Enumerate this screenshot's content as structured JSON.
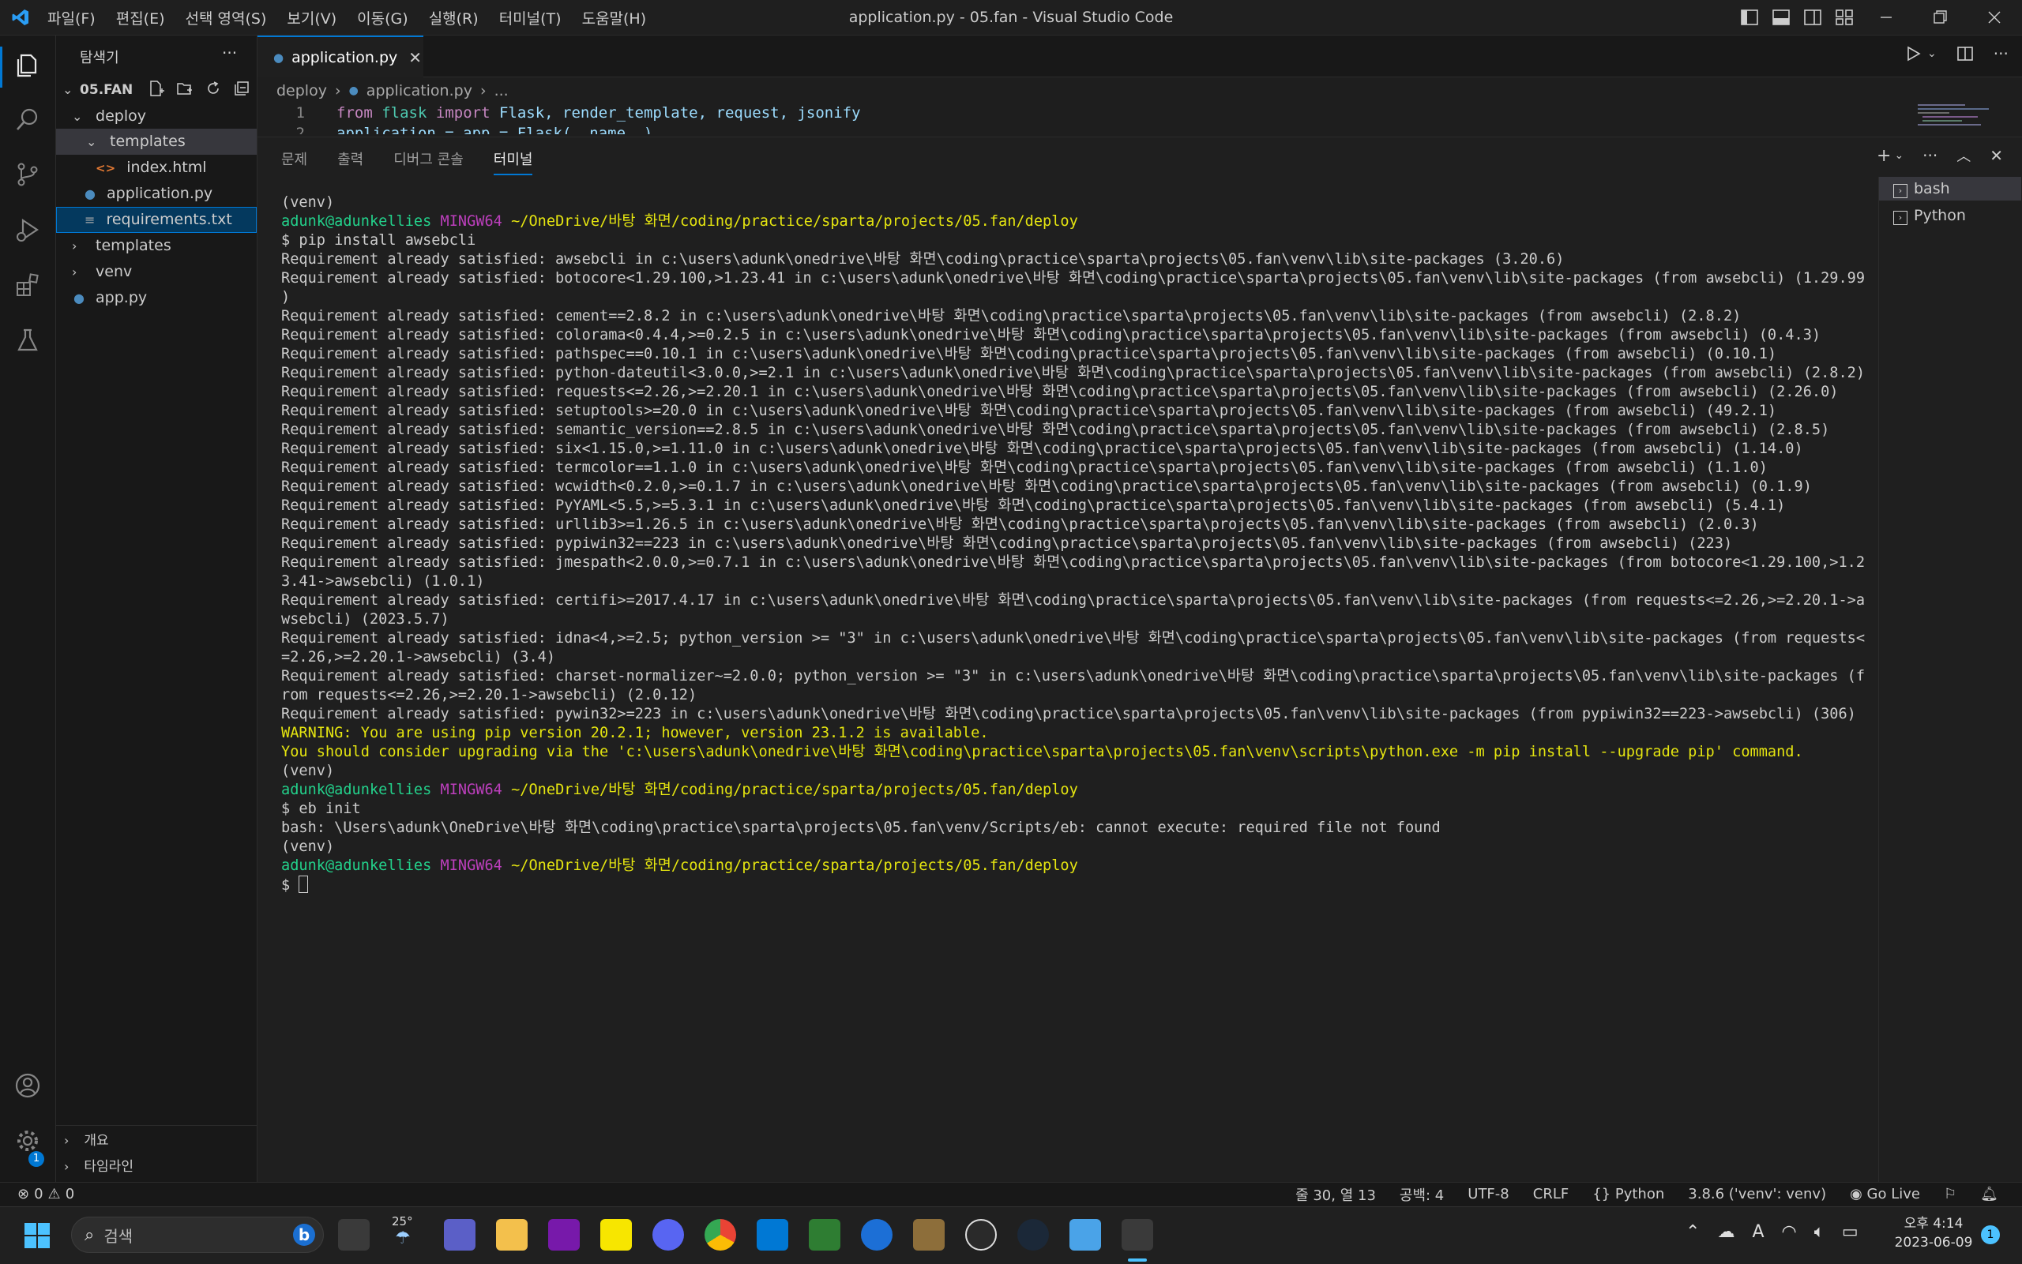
{
  "titlebar": {
    "menus": [
      "파일(F)",
      "편집(E)",
      "선택 영역(S)",
      "보기(V)",
      "이동(G)",
      "실행(R)",
      "터미널(T)",
      "도움말(H)"
    ],
    "window_title": "application.py - 05.fan - Visual Studio Code"
  },
  "sidebar": {
    "title": "탐색기",
    "root": "05.FAN",
    "items": [
      {
        "label": "deploy"
      },
      {
        "label": "templates"
      },
      {
        "label": "index.html"
      },
      {
        "label": "application.py"
      },
      {
        "label": "requirements.txt"
      },
      {
        "label": "templates"
      },
      {
        "label": "venv"
      },
      {
        "label": "app.py"
      }
    ],
    "bottom": [
      "개요",
      "타임라인"
    ]
  },
  "editor": {
    "tab": "application.py",
    "breadcrumb": [
      "deploy",
      "application.py",
      "..."
    ],
    "line1_no": "1",
    "line2_no": "2",
    "line1": {
      "k1": "from",
      "m": "flask",
      "k2": "import",
      "rest": "Flask, render_template, request, jsonify"
    },
    "line2": "application = app = Flask(__name__)"
  },
  "panel": {
    "tabs": [
      "문제",
      "출력",
      "디버그 콘솔",
      "터미널"
    ],
    "terminals": [
      "bash",
      "Python"
    ]
  },
  "terminal": {
    "venv": "(venv)",
    "user": "adunk@adunkellies",
    "host": "MINGW64",
    "path": "~/OneDrive/바탕 화면/coding/practice/sparta/projects/05.fan/deploy",
    "cmd1": "$ pip install awsebcli",
    "req": [
      "Requirement already satisfied: awsebcli in c:\\users\\adunk\\onedrive\\바탕 화면\\coding\\practice\\sparta\\projects\\05.fan\\venv\\lib\\site-packages (3.20.6)",
      "Requirement already satisfied: botocore<1.29.100,>1.23.41 in c:\\users\\adunk\\onedrive\\바탕 화면\\coding\\practice\\sparta\\projects\\05.fan\\venv\\lib\\site-packages (from awsebcli) (1.29.99",
      ")",
      "Requirement already satisfied: cement==2.8.2 in c:\\users\\adunk\\onedrive\\바탕 화면\\coding\\practice\\sparta\\projects\\05.fan\\venv\\lib\\site-packages (from awsebcli) (2.8.2)",
      "Requirement already satisfied: colorama<0.4.4,>=0.2.5 in c:\\users\\adunk\\onedrive\\바탕 화면\\coding\\practice\\sparta\\projects\\05.fan\\venv\\lib\\site-packages (from awsebcli) (0.4.3)",
      "Requirement already satisfied: pathspec==0.10.1 in c:\\users\\adunk\\onedrive\\바탕 화면\\coding\\practice\\sparta\\projects\\05.fan\\venv\\lib\\site-packages (from awsebcli) (0.10.1)",
      "Requirement already satisfied: python-dateutil<3.0.0,>=2.1 in c:\\users\\adunk\\onedrive\\바탕 화면\\coding\\practice\\sparta\\projects\\05.fan\\venv\\lib\\site-packages (from awsebcli) (2.8.2)",
      "Requirement already satisfied: requests<=2.26,>=2.20.1 in c:\\users\\adunk\\onedrive\\바탕 화면\\coding\\practice\\sparta\\projects\\05.fan\\venv\\lib\\site-packages (from awsebcli) (2.26.0)",
      "Requirement already satisfied: setuptools>=20.0 in c:\\users\\adunk\\onedrive\\바탕 화면\\coding\\practice\\sparta\\projects\\05.fan\\venv\\lib\\site-packages (from awsebcli) (49.2.1)",
      "Requirement already satisfied: semantic_version==2.8.5 in c:\\users\\adunk\\onedrive\\바탕 화면\\coding\\practice\\sparta\\projects\\05.fan\\venv\\lib\\site-packages (from awsebcli) (2.8.5)",
      "Requirement already satisfied: six<1.15.0,>=1.11.0 in c:\\users\\adunk\\onedrive\\바탕 화면\\coding\\practice\\sparta\\projects\\05.fan\\venv\\lib\\site-packages (from awsebcli) (1.14.0)",
      "Requirement already satisfied: termcolor==1.1.0 in c:\\users\\adunk\\onedrive\\바탕 화면\\coding\\practice\\sparta\\projects\\05.fan\\venv\\lib\\site-packages (from awsebcli) (1.1.0)",
      "Requirement already satisfied: wcwidth<0.2.0,>=0.1.7 in c:\\users\\adunk\\onedrive\\바탕 화면\\coding\\practice\\sparta\\projects\\05.fan\\venv\\lib\\site-packages (from awsebcli) (0.1.9)",
      "Requirement already satisfied: PyYAML<5.5,>=5.3.1 in c:\\users\\adunk\\onedrive\\바탕 화면\\coding\\practice\\sparta\\projects\\05.fan\\venv\\lib\\site-packages (from awsebcli) (5.4.1)",
      "Requirement already satisfied: urllib3>=1.26.5 in c:\\users\\adunk\\onedrive\\바탕 화면\\coding\\practice\\sparta\\projects\\05.fan\\venv\\lib\\site-packages (from awsebcli) (2.0.3)",
      "Requirement already satisfied: pypiwin32==223 in c:\\users\\adunk\\onedrive\\바탕 화면\\coding\\practice\\sparta\\projects\\05.fan\\venv\\lib\\site-packages (from awsebcli) (223)",
      "Requirement already satisfied: jmespath<2.0.0,>=0.7.1 in c:\\users\\adunk\\onedrive\\바탕 화면\\coding\\practice\\sparta\\projects\\05.fan\\venv\\lib\\site-packages (from botocore<1.29.100,>1.2",
      "3.41->awsebcli) (1.0.1)",
      "Requirement already satisfied: certifi>=2017.4.17 in c:\\users\\adunk\\onedrive\\바탕 화면\\coding\\practice\\sparta\\projects\\05.fan\\venv\\lib\\site-packages (from requests<=2.26,>=2.20.1->a",
      "wsebcli) (2023.5.7)",
      "Requirement already satisfied: idna<4,>=2.5; python_version >= \"3\" in c:\\users\\adunk\\onedrive\\바탕 화면\\coding\\practice\\sparta\\projects\\05.fan\\venv\\lib\\site-packages (from requests<",
      "=2.26,>=2.20.1->awsebcli) (3.4)",
      "Requirement already satisfied: charset-normalizer~=2.0.0; python_version >= \"3\" in c:\\users\\adunk\\onedrive\\바탕 화면\\coding\\practice\\sparta\\projects\\05.fan\\venv\\lib\\site-packages (f",
      "rom requests<=2.26,>=2.20.1->awsebcli) (2.0.12)",
      "Requirement already satisfied: pywin32>=223 in c:\\users\\adunk\\onedrive\\바탕 화면\\coding\\practice\\sparta\\projects\\05.fan\\venv\\lib\\site-packages (from pypiwin32==223->awsebcli) (306)"
    ],
    "warning1": "WARNING: You are using pip version 20.2.1; however, version 23.1.2 is available.",
    "warning2": "You should consider upgrading via the 'c:\\users\\adunk\\onedrive\\바탕 화면\\coding\\practice\\sparta\\projects\\05.fan\\venv\\scripts\\python.exe -m pip install --upgrade pip' command.",
    "cmd2": "$ eb init",
    "error": "bash: \\Users\\adunk\\OneDrive\\바탕 화면\\coding\\practice\\sparta\\projects\\05.fan\\venv/Scripts/eb: cannot execute: required file not found",
    "prompt": "$ "
  },
  "status": {
    "errors": "0",
    "warnings": "0",
    "position": "줄 30, 열 13",
    "spaces": "공백: 4",
    "encoding": "UTF-8",
    "eol": "CRLF",
    "language": "Python",
    "interpreter": "3.8.6 ('venv': venv)",
    "golive": "Go Live"
  },
  "taskbar": {
    "search_placeholder": "검색",
    "weather": "25°",
    "time": "오후 4:14",
    "date": "2023-06-09",
    "notifications": "1"
  },
  "colors": {
    "accent": "#0078d4",
    "prompt_user": "#23d18b",
    "prompt_host": "#bc3fbc",
    "warning": "#e5e510"
  }
}
